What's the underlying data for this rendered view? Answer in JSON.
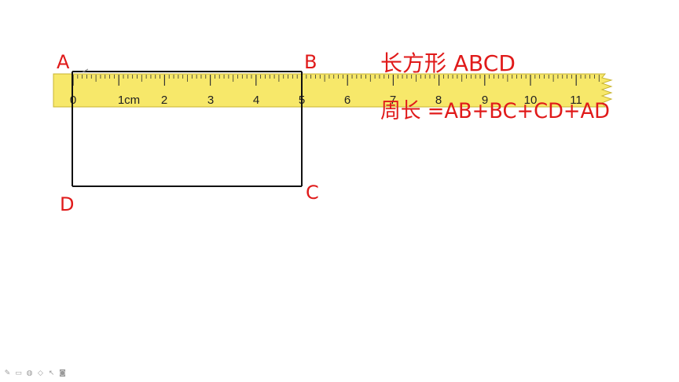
{
  "ruler": {
    "unit_label": "1cm",
    "numbers": [
      "0",
      "",
      "2",
      "3",
      "4",
      "5",
      "6",
      "7",
      "8",
      "9",
      "10",
      "11"
    ],
    "color": "#f7e86a",
    "edge_color": "#c9b530"
  },
  "rectangle": {
    "labels": {
      "a": "A",
      "b": "B",
      "c": "C",
      "d": "D"
    },
    "stroke": "#111111"
  },
  "notes": {
    "line1": "长方形 ABCD",
    "line2": "周长 =AB+BC+CD+AD",
    "color": "#e01a1a"
  },
  "toolbar": {
    "icons": [
      "pen-icon",
      "eraser-icon",
      "marker-icon",
      "shape-icon",
      "pointer-icon",
      "camera-icon"
    ]
  }
}
